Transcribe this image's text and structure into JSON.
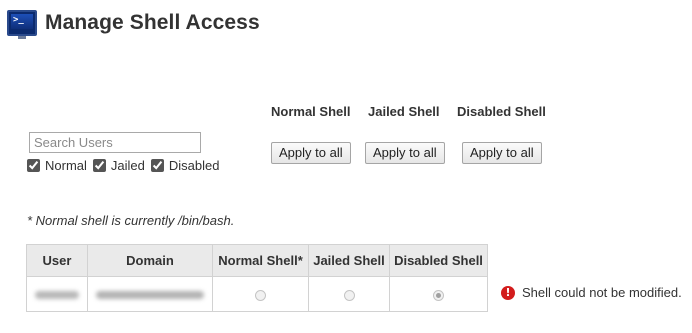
{
  "header": {
    "title": "Manage Shell Access",
    "icon": "terminal-icon",
    "icon_glyph": ">_"
  },
  "search": {
    "placeholder": "Search Users",
    "value": ""
  },
  "filters": [
    {
      "label": "Normal",
      "checked": true
    },
    {
      "label": "Jailed",
      "checked": true
    },
    {
      "label": "Disabled",
      "checked": true
    }
  ],
  "bulk": {
    "columns": [
      {
        "heading": "Normal Shell",
        "button": "Apply to all"
      },
      {
        "heading": "Jailed Shell",
        "button": "Apply to all"
      },
      {
        "heading": "Disabled Shell",
        "button": "Apply to all"
      }
    ]
  },
  "note": "* Normal shell is currently /bin/bash.",
  "table": {
    "headers": [
      "User",
      "Domain",
      "Normal Shell*",
      "Jailed Shell",
      "Disabled Shell"
    ],
    "rows": [
      {
        "user": "",
        "domain": "",
        "selected": "Disabled Shell",
        "redacted": true
      }
    ]
  },
  "status": {
    "icon": "error-icon",
    "icon_glyph": "!",
    "message": "Shell could not be modified.",
    "color": "#d31c1c"
  }
}
